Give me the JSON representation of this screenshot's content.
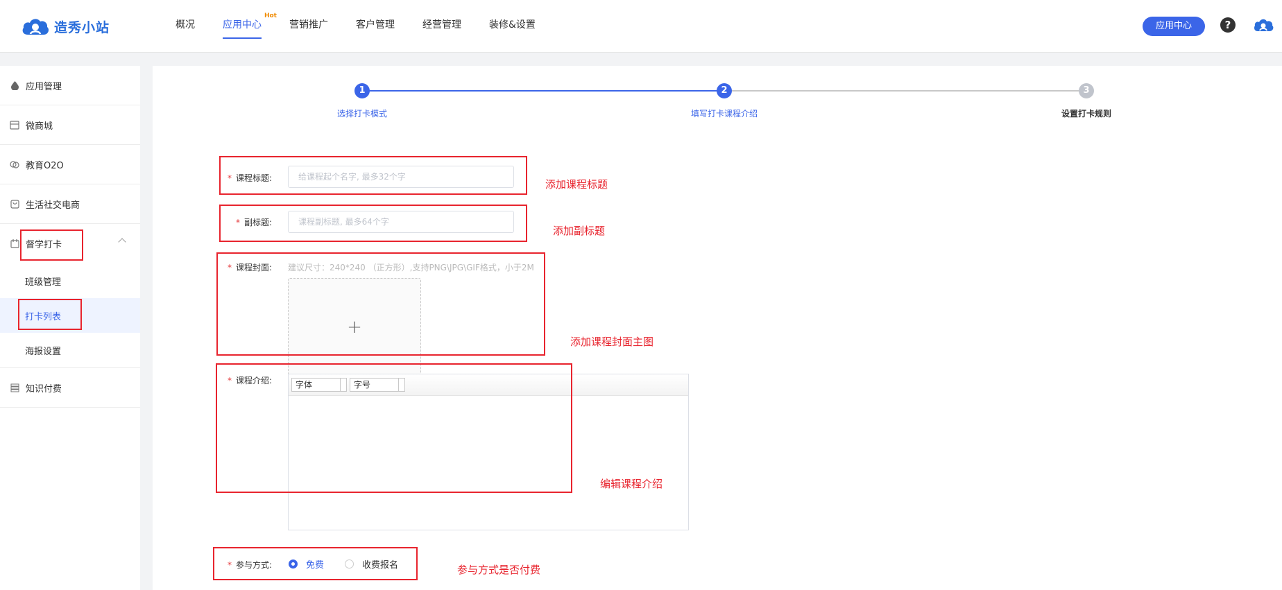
{
  "logo": {
    "text": "造秀小站"
  },
  "nav": {
    "items": [
      {
        "label": "概况"
      },
      {
        "label": "应用中心",
        "badge": "Hot",
        "active": true
      },
      {
        "label": "营销推广"
      },
      {
        "label": "客户管理"
      },
      {
        "label": "经营管理"
      },
      {
        "label": "装修&设置"
      }
    ],
    "app_center_button": "应用中心",
    "help": "?"
  },
  "sidebar": {
    "items": [
      {
        "label": "应用管理",
        "icon": "drop-icon"
      },
      {
        "label": "微商城",
        "icon": "shop-icon"
      },
      {
        "label": "教育O2O",
        "icon": "edu-icon"
      },
      {
        "label": "生活社交电商",
        "icon": "bag-icon"
      },
      {
        "label": "督学打卡",
        "icon": "calendar-icon",
        "expanded": true,
        "children": [
          {
            "label": "班级管理"
          },
          {
            "label": "打卡列表",
            "active": true
          },
          {
            "label": "海报设置"
          }
        ]
      },
      {
        "label": "知识付费",
        "icon": "book-icon"
      }
    ]
  },
  "steps": [
    {
      "num": "1",
      "label": "选择打卡模式",
      "state": "done"
    },
    {
      "num": "2",
      "label": "填写打卡课程介绍",
      "state": "active"
    },
    {
      "num": "3",
      "label": "设置打卡规则",
      "state": "pending"
    }
  ],
  "form": {
    "required_mark": "*",
    "title": {
      "label": "课程标题:",
      "placeholder": "给课程起个名字, 最多32个字"
    },
    "subtitle": {
      "label": "副标题:",
      "placeholder": "课程副标题, 最多64个字"
    },
    "cover": {
      "label": "课程封面:",
      "hint": "建议尺寸：240*240 （正方形）,支持PNG\\JPG\\GIF格式，小于2M",
      "plus": "+"
    },
    "intro": {
      "label": "课程介绍:",
      "font_select": "字体",
      "size_select": "字号"
    },
    "participation": {
      "label": "参与方式:",
      "options": [
        {
          "label": "免费",
          "checked": true
        },
        {
          "label": "收费报名",
          "checked": false
        }
      ]
    }
  },
  "annotations": {
    "title": "添加课程标题",
    "subtitle": "添加副标题",
    "cover": "添加课程封面主图",
    "intro": "编辑课程介绍",
    "participation": "参与方式是否付费"
  },
  "colors": {
    "primary": "#3b65e8",
    "annotation": "#e8242e",
    "hot": "#f08a00",
    "step_pending": "#c0c4cc"
  }
}
